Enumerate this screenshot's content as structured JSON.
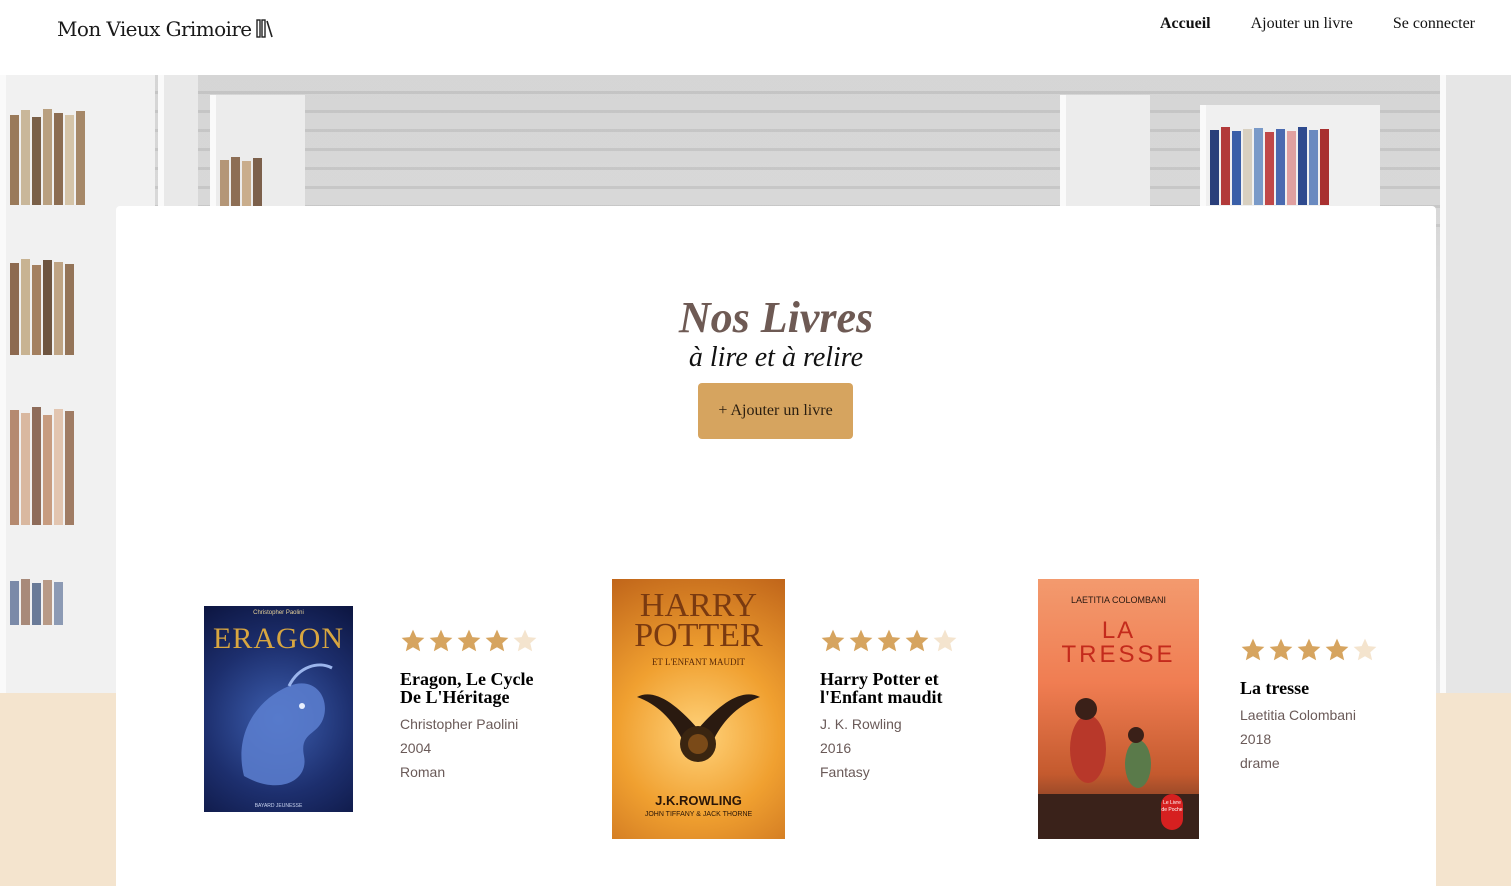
{
  "header": {
    "logo_text": "Mon Vieux Grimoire",
    "logo_icon": "books-icon",
    "nav": [
      {
        "label": "Accueil",
        "active": true
      },
      {
        "label": "Ajouter un livre",
        "active": false
      },
      {
        "label": "Se connecter",
        "active": false
      }
    ]
  },
  "main": {
    "title": "Nos Livres",
    "subtitle": "à lire et à relire",
    "add_button": "+ Ajouter un livre"
  },
  "colors": {
    "accent": "#d6a45f",
    "star_filled": "#d6a45f",
    "star_empty": "#f4e4ce",
    "page_bg": "#f4e4ce",
    "title": "#6e5a54"
  },
  "books": [
    {
      "title": "Eragon, Le Cycle De L'Héritage",
      "author": "Christopher Paolini",
      "year": "2004",
      "genre": "Roman",
      "rating": 4,
      "rating_max": 5,
      "cover_text": {
        "top": "Christopher Paolini",
        "main": "ERAGON",
        "bottom": "BAYARD JEUNESSE"
      }
    },
    {
      "title": "Harry Potter et l'Enfant maudit",
      "author": "J. K. Rowling",
      "year": "2016",
      "genre": "Fantasy",
      "rating": 4,
      "rating_max": 5,
      "cover_text": {
        "main1": "HARRY",
        "main2": "POTTER",
        "sub": "ET L'ENFANT MAUDIT",
        "author": "J.K.ROWLING",
        "coauthors": "JOHN TIFFANY & JACK THORNE"
      }
    },
    {
      "title": "La tresse",
      "author": "Laetitia Colombani",
      "year": "2018",
      "genre": "drame",
      "rating": 4,
      "rating_max": 5,
      "cover_text": {
        "author": "LAETITIA COLOMBANI",
        "main1": "LA",
        "main2": "TRESSE",
        "badge": "Le Livre de Poche"
      }
    }
  ]
}
